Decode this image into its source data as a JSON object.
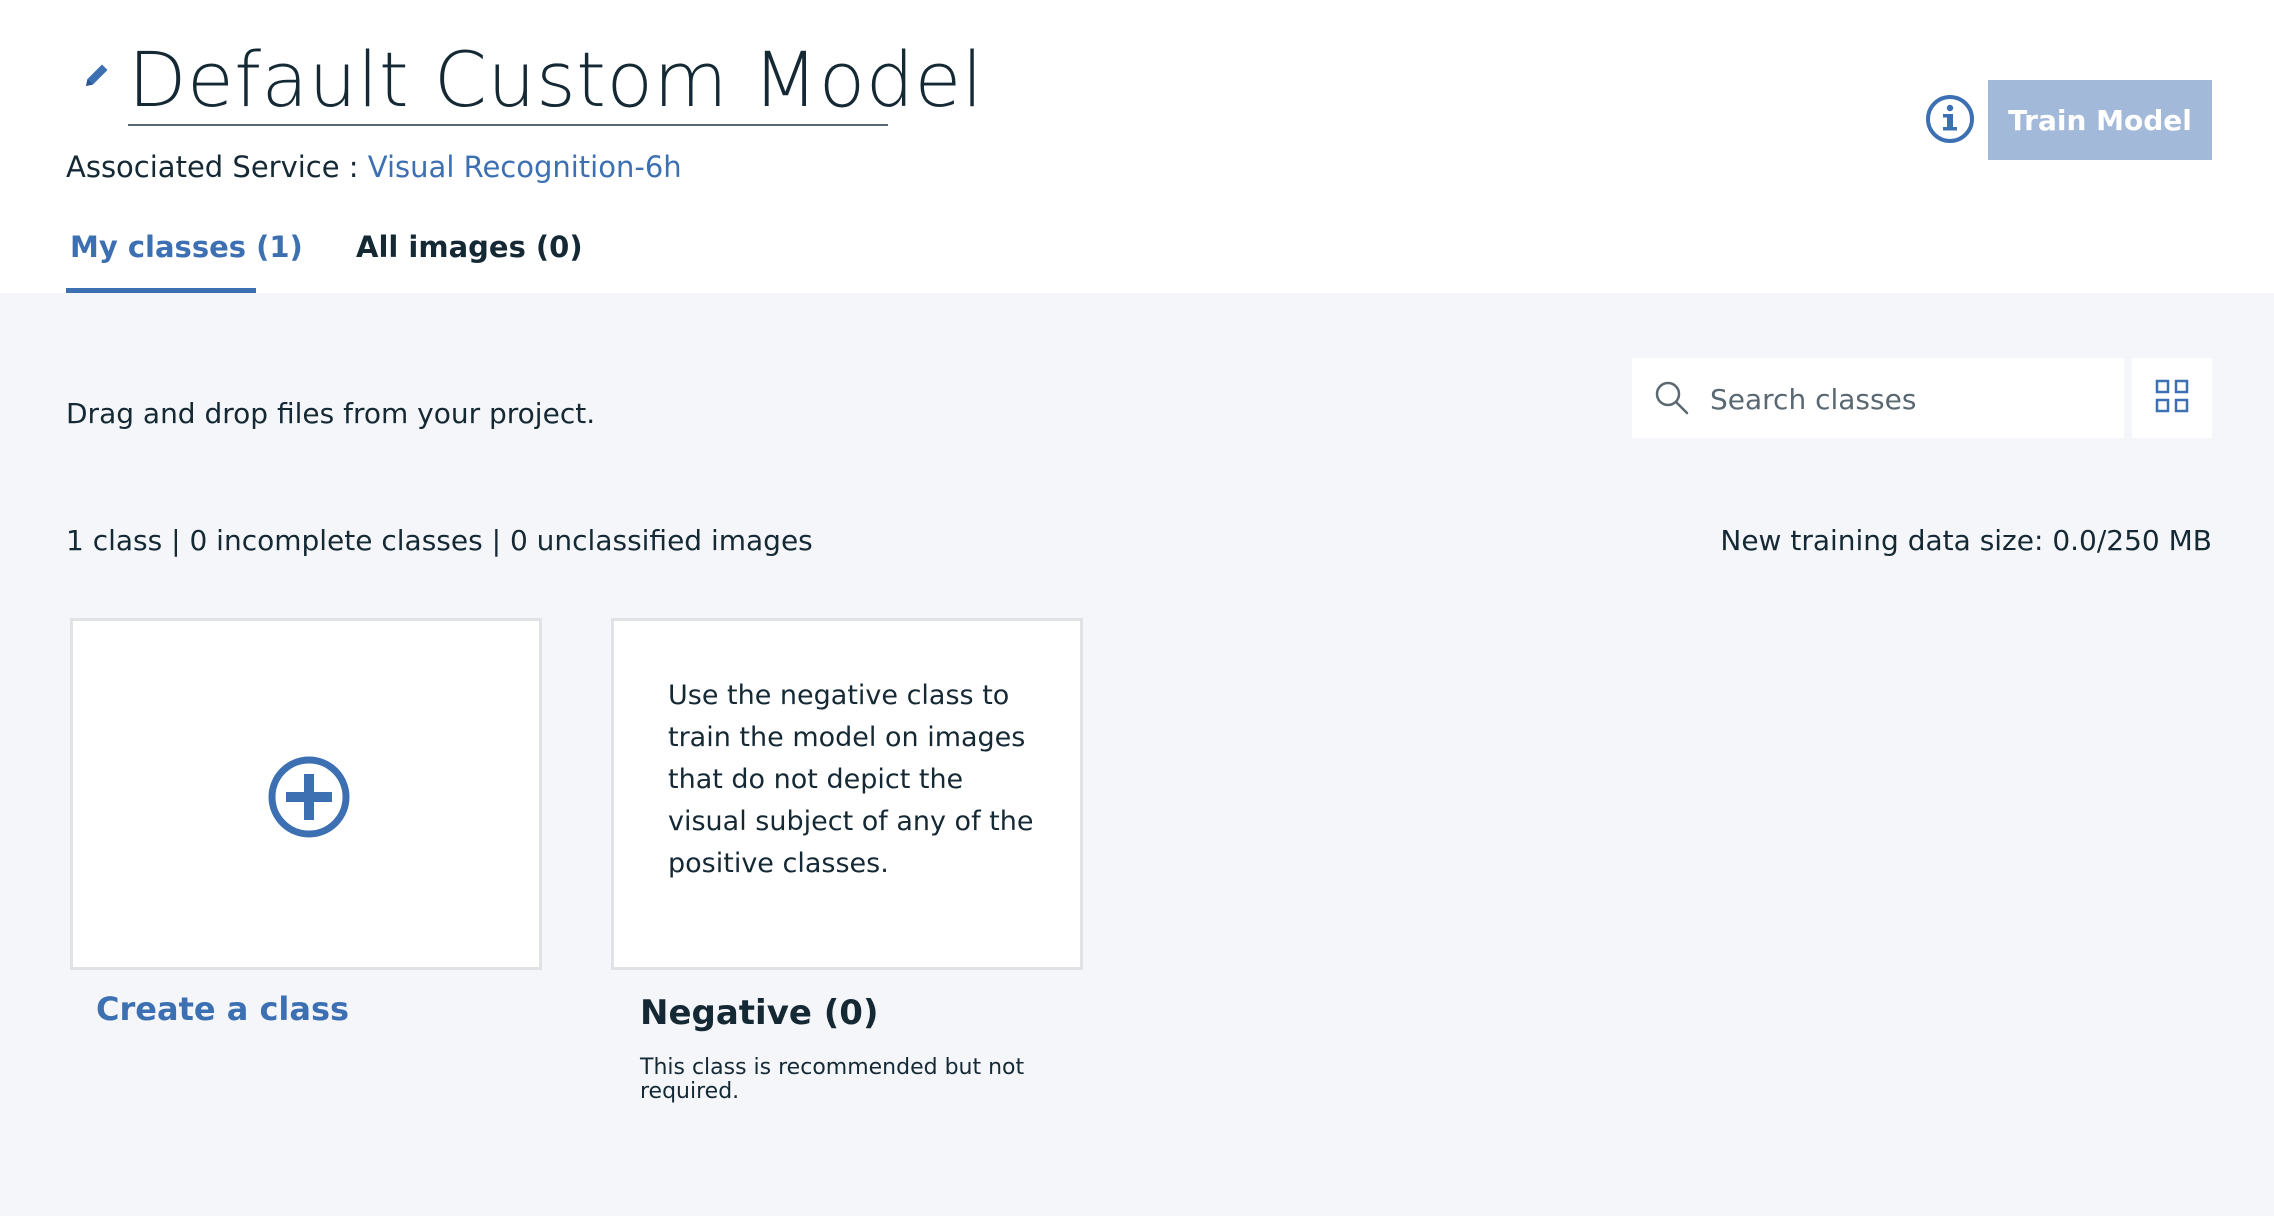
{
  "header": {
    "title": "Default Custom Model",
    "associated_label": "Associated Service :",
    "associated_service": "Visual Recognition-6h",
    "train_button": "Train Model"
  },
  "tabs": [
    {
      "label": "My classes (1)",
      "active": true
    },
    {
      "label": "All images (0)",
      "active": false
    }
  ],
  "main": {
    "dragdrop_hint": "Drag and drop files from your project.",
    "search_placeholder": "Search classes",
    "summary": "1 class | 0 incomplete classes | 0 unclassified images",
    "data_size": "New training data size: 0.0/250 MB"
  },
  "cards": {
    "create_label": "Create a class",
    "negative_text": "Use the negative class to train the model on images that do not depict the visual subject of any of the positive classes.",
    "negative_label": "Negative (0)",
    "negative_note": "This class is recommended but not required."
  },
  "icons": {
    "edit": "pencil-icon",
    "info": "info-icon",
    "search": "search-icon",
    "grid": "grid-view-icon",
    "add": "plus-circle-icon"
  },
  "colors": {
    "accent": "#3d70b2",
    "train_disabled": "#a3b9da",
    "background": "#f4f6f9",
    "text": "#152935"
  }
}
